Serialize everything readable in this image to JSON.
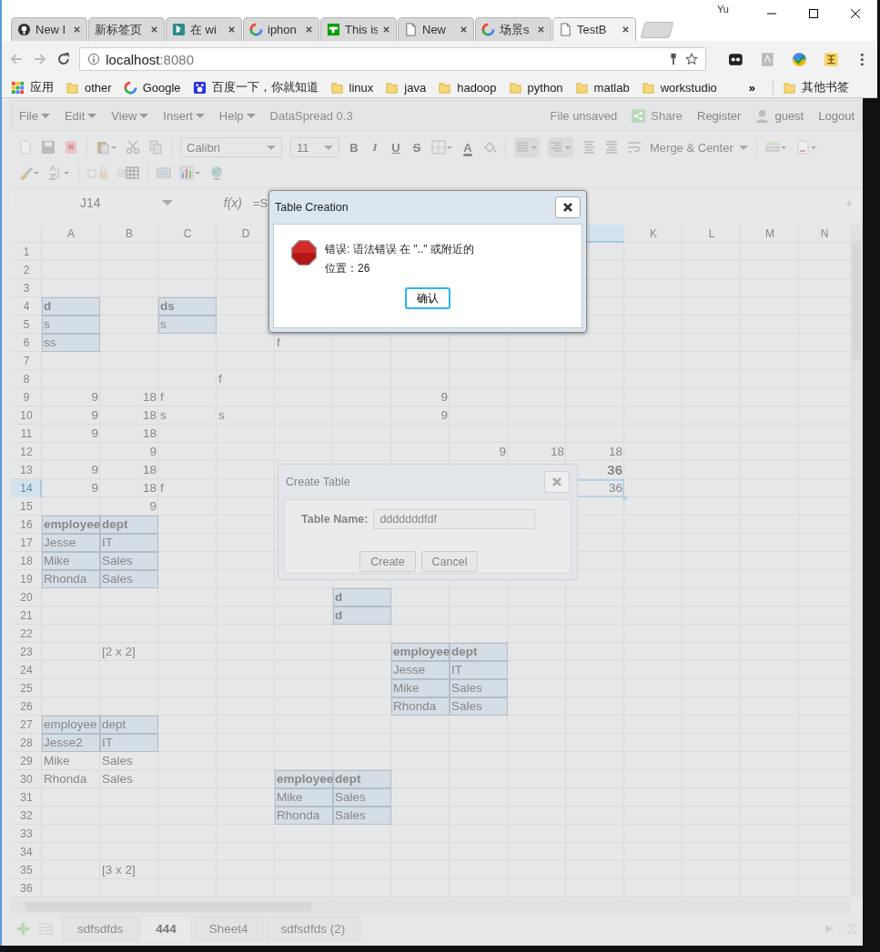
{
  "browser": {
    "tabs": [
      {
        "title": "New I",
        "selected": false
      },
      {
        "title": "新标签页",
        "selected": false
      },
      {
        "title": "在 wi",
        "selected": false
      },
      {
        "title": "iphon",
        "selected": false
      },
      {
        "title": "This is",
        "selected": false
      },
      {
        "title": "New",
        "selected": false
      },
      {
        "title": "场景s",
        "selected": false
      },
      {
        "title": "TestB",
        "selected": true
      }
    ],
    "profile": "Yu",
    "address": {
      "host": "localhost",
      "port": ":8080"
    },
    "bookmarks": [
      "应用",
      "other",
      "Google",
      "百度一下，你就知道",
      "linux",
      "java",
      "hadoop",
      "python",
      "matlab",
      "workstudio"
    ],
    "overflow": "»",
    "other_bookmarks": "其他书签"
  },
  "app": {
    "menus": [
      "File",
      "Edit",
      "View",
      "Insert",
      "Help"
    ],
    "version": "DataSpread 0.3",
    "status": "File unsaved",
    "share": "Share",
    "register": "Register",
    "user": "guest",
    "logout": "Logout",
    "toolbar": {
      "font": "Calibri",
      "size": "11",
      "format": [
        "B",
        "I",
        "U",
        "S"
      ],
      "font_color": "A",
      "merge": "Merge & Center"
    },
    "formula_bar": {
      "cell": "J14",
      "fx": "f(x)",
      "formula": "=S"
    },
    "grid": {
      "left_headers": [
        "A",
        "B",
        "C",
        "D"
      ],
      "right_headers": [
        "K",
        "L",
        "M",
        "N"
      ],
      "rows": [
        {
          "number": "1"
        },
        {
          "number": "2"
        },
        {
          "number": "3"
        },
        {
          "number": "4",
          "cells": [
            {
              "text": "d",
              "kind": "table_head",
              "selected": false
            },
            "",
            {
              "text": "ds",
              "kind": "table_head",
              "selected": false
            }
          ]
        },
        {
          "number": "5",
          "cells": [
            {
              "text": "s",
              "kind": "table_cell",
              "selected": false
            },
            "",
            {
              "text": "s",
              "kind": "table_cell",
              "selected": false
            }
          ]
        },
        {
          "number": "6",
          "cells": [
            {
              "text": "ss",
              "kind": "table_cell",
              "selected": false
            },
            "",
            "",
            "",
            {
              "text": "f",
              "kind": "text",
              "selected": false
            }
          ]
        },
        {
          "number": "7"
        },
        {
          "number": "8",
          "cells": [
            "",
            "",
            "",
            {
              "text": "f",
              "kind": "text",
              "selected": false
            }
          ]
        },
        {
          "number": "9",
          "cells": [
            {
              "text": "9",
              "kind": "number",
              "selected": false
            },
            {
              "text": "18",
              "kind": "number",
              "selected": false
            },
            {
              "text": "f",
              "kind": "text",
              "selected": false
            },
            "",
            "",
            "",
            {
              "text": "9",
              "kind": "number",
              "selected": false
            }
          ]
        },
        {
          "number": "10",
          "cells": [
            {
              "text": "9",
              "kind": "number",
              "selected": false
            },
            {
              "text": "18",
              "kind": "number",
              "selected": false
            },
            {
              "text": "s",
              "kind": "text",
              "selected": false
            },
            {
              "text": "s",
              "kind": "text",
              "selected": false
            },
            "",
            "",
            {
              "text": "9",
              "kind": "number",
              "selected": false
            }
          ]
        },
        {
          "number": "11",
          "cells": [
            {
              "text": "9",
              "kind": "number",
              "selected": false
            },
            {
              "text": "18",
              "kind": "number",
              "selected": false
            }
          ]
        },
        {
          "number": "12",
          "cells": [
            "",
            {
              "text": "9",
              "kind": "number",
              "selected": false
            },
            "",
            "",
            "",
            "",
            "",
            {
              "text": "9",
              "kind": "number",
              "selected": false
            },
            {
              "text": "18",
              "kind": "number",
              "selected": false
            },
            {
              "text": "18",
              "kind": "number",
              "selected": false
            }
          ]
        },
        {
          "number": "13",
          "cells": [
            {
              "text": "9",
              "kind": "number",
              "selected": false
            },
            {
              "text": "18",
              "kind": "number",
              "selected": false
            },
            "",
            "",
            "",
            "",
            "",
            "",
            "",
            {
              "text": "36",
              "kind": "total",
              "selected": false
            }
          ]
        },
        {
          "number": "14",
          "cells": [
            {
              "text": "9",
              "kind": "number",
              "selected": false
            },
            {
              "text": "18",
              "kind": "number",
              "selected": false
            },
            {
              "text": "f",
              "kind": "text",
              "selected": false
            },
            "",
            "",
            "",
            "",
            "",
            "",
            {
              "text": "36",
              "kind": "number",
              "selected": true
            }
          ]
        },
        {
          "number": "15",
          "cells": [
            "",
            {
              "text": "9",
              "kind": "number",
              "selected": false
            }
          ]
        },
        {
          "number": "16",
          "cells": [
            {
              "text": "employee",
              "kind": "table_head",
              "selected": false
            },
            {
              "text": "dept",
              "kind": "table_head",
              "selected": false
            }
          ]
        },
        {
          "number": "17",
          "cells": [
            {
              "text": "Jesse",
              "kind": "table_cell",
              "selected": false
            },
            {
              "text": "IT",
              "kind": "table_cell",
              "selected": false
            }
          ]
        },
        {
          "number": "18",
          "cells": [
            {
              "text": "Mike",
              "kind": "table_cell",
              "selected": false
            },
            {
              "text": "Sales",
              "kind": "table_cell",
              "selected": false
            }
          ]
        },
        {
          "number": "19",
          "cells": [
            {
              "text": "Rhonda",
              "kind": "table_cell",
              "selected": false
            },
            {
              "text": "Sales",
              "kind": "table_cell",
              "selected": false
            }
          ]
        },
        {
          "number": "20",
          "cells": [
            "",
            "",
            "",
            "",
            "",
            {
              "text": "d",
              "kind": "table_head",
              "selected": false
            }
          ]
        },
        {
          "number": "21",
          "cells": [
            "",
            "",
            "",
            "",
            "",
            {
              "text": "d",
              "kind": "table_head",
              "selected": false
            }
          ]
        },
        {
          "number": "22"
        },
        {
          "number": "23",
          "cells": [
            "",
            {
              "text": "[2 x 2]",
              "kind": "text",
              "selected": false
            },
            "",
            "",
            "",
            "",
            {
              "text": "employee",
              "kind": "table_head",
              "selected": false
            },
            {
              "text": "dept",
              "kind": "table_head",
              "selected": false
            }
          ]
        },
        {
          "number": "24",
          "cells": [
            "",
            "",
            "",
            "",
            "",
            "",
            {
              "text": "Jesse",
              "kind": "table_cell",
              "selected": false
            },
            {
              "text": "IT",
              "kind": "table_cell",
              "selected": false
            }
          ]
        },
        {
          "number": "25",
          "cells": [
            "",
            "",
            "",
            "",
            "",
            "",
            {
              "text": "Mike",
              "kind": "table_cell",
              "selected": false
            },
            {
              "text": "Sales",
              "kind": "table_cell",
              "selected": false
            }
          ]
        },
        {
          "number": "26",
          "cells": [
            "",
            "",
            "",
            "",
            "",
            "",
            {
              "text": "Rhonda",
              "kind": "table_cell",
              "selected": false
            },
            {
              "text": "Sales",
              "kind": "table_cell",
              "selected": false
            }
          ]
        },
        {
          "number": "27",
          "cells": [
            {
              "text": "employee",
              "kind": "table_cell",
              "selected": false
            },
            {
              "text": "dept",
              "kind": "table_cell",
              "selected": false
            }
          ]
        },
        {
          "number": "28",
          "cells": [
            {
              "text": "Jesse2",
              "kind": "table_cell",
              "selected": false
            },
            {
              "text": "IT",
              "kind": "table_cell",
              "selected": false
            }
          ]
        },
        {
          "number": "29",
          "cells": [
            {
              "text": "Mike",
              "kind": "text",
              "selected": false
            },
            {
              "text": "Sales",
              "kind": "text",
              "selected": false
            }
          ]
        },
        {
          "number": "30",
          "cells": [
            {
              "text": "Rhonda",
              "kind": "text",
              "selected": false
            },
            {
              "text": "Sales",
              "kind": "text",
              "selected": false
            },
            "",
            "",
            {
              "text": "employee",
              "kind": "table_head",
              "selected": false
            },
            {
              "text": "dept",
              "kind": "table_head",
              "selected": false
            }
          ]
        },
        {
          "number": "31",
          "cells": [
            "",
            "",
            "",
            "",
            {
              "text": "Mike",
              "kind": "table_cell",
              "selected": false
            },
            {
              "text": "Sales",
              "kind": "table_cell",
              "selected": false
            }
          ]
        },
        {
          "number": "32",
          "cells": [
            "",
            "",
            "",
            "",
            {
              "text": "Rhonda",
              "kind": "table_cell",
              "selected": false
            },
            {
              "text": "Sales",
              "kind": "table_cell",
              "selected": false
            }
          ]
        },
        {
          "number": "33"
        },
        {
          "number": "34"
        },
        {
          "number": "35",
          "cells": [
            "",
            {
              "text": "[3 x 2]",
              "kind": "text",
              "selected": false
            }
          ]
        },
        {
          "number": "36"
        }
      ]
    },
    "sheets": [
      {
        "name": "sdfsdfds",
        "selected": false
      },
      {
        "name": "444",
        "selected": true
      },
      {
        "name": "Sheet4",
        "selected": false
      },
      {
        "name": "sdfsdfds (2)",
        "selected": false
      }
    ]
  },
  "error_dialog": {
    "title": "Table Creation",
    "lines": [
      "错误: 语法错误 在 \"..\" 或附近的",
      "位置：26"
    ],
    "button": "确认"
  },
  "create_dialog": {
    "title": "Create Table",
    "label": "Table Name:",
    "value": "dddddddfdf",
    "buttons": [
      "Create",
      "Cancel"
    ]
  }
}
